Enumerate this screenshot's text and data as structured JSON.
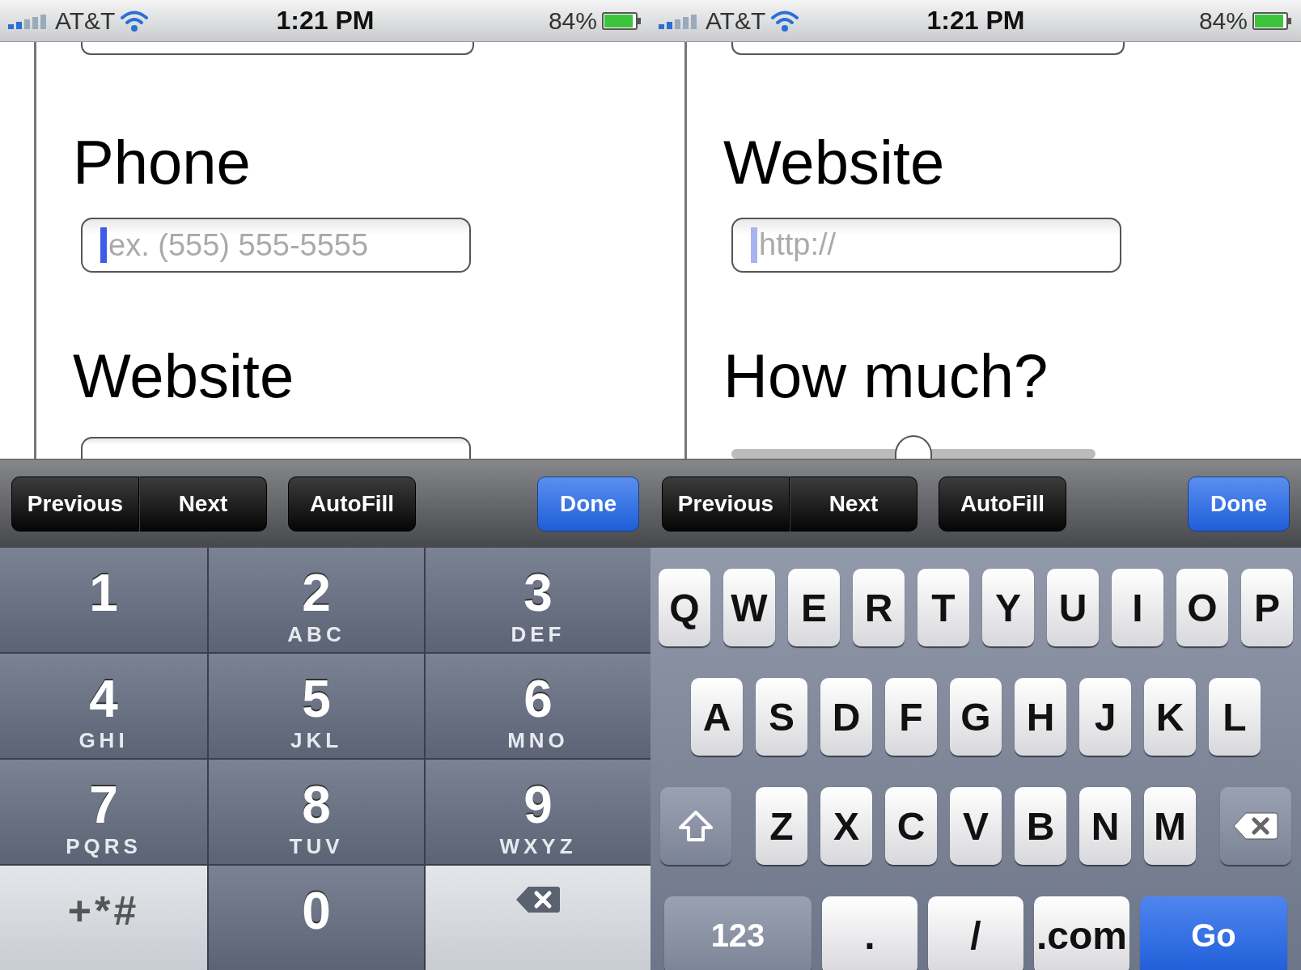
{
  "screens": [
    {
      "status_bar": {
        "carrier": "AT&T",
        "time": "1:21 PM",
        "battery": "84%"
      },
      "form": [
        {
          "kind": "field-edge"
        },
        {
          "kind": "label",
          "text": "Phone"
        },
        {
          "kind": "field",
          "placeholder": "ex. (555) 555-5555",
          "focused": true
        },
        {
          "kind": "label",
          "text": "Website"
        },
        {
          "kind": "field",
          "focused": false
        }
      ],
      "toolbar": [
        {
          "kind": "segment",
          "label": "Previous"
        },
        {
          "kind": "segment",
          "label": "Next"
        },
        {
          "kind": "plain",
          "label": "AutoFill"
        },
        {
          "kind": "primary",
          "label": "Done"
        }
      ],
      "keyboard": {
        "kind": "phone",
        "keys": [
          {
            "kind": "digit",
            "digit": "1"
          },
          {
            "kind": "digit",
            "digit": "2",
            "letters": "ABC"
          },
          {
            "kind": "digit",
            "digit": "3",
            "letters": "DEF"
          },
          {
            "kind": "digit",
            "digit": "4",
            "letters": "GHI"
          },
          {
            "kind": "digit",
            "digit": "5",
            "letters": "JKL"
          },
          {
            "kind": "digit",
            "digit": "6",
            "letters": "MNO"
          },
          {
            "kind": "digit",
            "digit": "7",
            "letters": "PQRS"
          },
          {
            "kind": "digit",
            "digit": "8",
            "letters": "TUV"
          },
          {
            "kind": "digit",
            "digit": "9",
            "letters": "WXYZ"
          },
          {
            "kind": "symbols",
            "label": "+*#"
          },
          {
            "kind": "digit",
            "digit": "0"
          },
          {
            "kind": "backspace"
          }
        ]
      }
    },
    {
      "status_bar": {
        "carrier": "AT&T",
        "time": "1:21 PM",
        "battery": "84%"
      },
      "form": [
        {
          "kind": "field-edge"
        },
        {
          "kind": "label",
          "text": "Website"
        },
        {
          "kind": "field",
          "placeholder": "http://",
          "focused": true
        },
        {
          "kind": "label",
          "text": "How much?"
        },
        {
          "kind": "slider",
          "level": 0.5
        }
      ],
      "toolbar": [
        {
          "kind": "segment",
          "label": "Previous"
        },
        {
          "kind": "segment",
          "label": "Next"
        },
        {
          "kind": "plain",
          "label": "AutoFill"
        },
        {
          "kind": "primary",
          "label": "Done"
        }
      ],
      "keyboard": {
        "kind": "qwerty",
        "rows": [
          [
            {
              "kind": "letter",
              "label": "Q"
            },
            {
              "kind": "letter",
              "label": "W"
            },
            {
              "kind": "letter",
              "label": "E"
            },
            {
              "kind": "letter",
              "label": "R"
            },
            {
              "kind": "letter",
              "label": "T"
            },
            {
              "kind": "letter",
              "label": "Y"
            },
            {
              "kind": "letter",
              "label": "U"
            },
            {
              "kind": "letter",
              "label": "I"
            },
            {
              "kind": "letter",
              "label": "O"
            },
            {
              "kind": "letter",
              "label": "P"
            }
          ],
          [
            {
              "kind": "letter",
              "label": "A"
            },
            {
              "kind": "letter",
              "label": "S"
            },
            {
              "kind": "letter",
              "label": "D"
            },
            {
              "kind": "letter",
              "label": "F"
            },
            {
              "kind": "letter",
              "label": "G"
            },
            {
              "kind": "letter",
              "label": "H"
            },
            {
              "kind": "letter",
              "label": "J"
            },
            {
              "kind": "letter",
              "label": "K"
            },
            {
              "kind": "letter",
              "label": "L"
            }
          ],
          [
            {
              "kind": "shift"
            },
            {
              "kind": "letter",
              "label": "Z"
            },
            {
              "kind": "letter",
              "label": "X"
            },
            {
              "kind": "letter",
              "label": "C"
            },
            {
              "kind": "letter",
              "label": "V"
            },
            {
              "kind": "letter",
              "label": "B"
            },
            {
              "kind": "letter",
              "label": "N"
            },
            {
              "kind": "letter",
              "label": "M"
            },
            {
              "kind": "backspace"
            }
          ]
        ],
        "bottom_row": [
          {
            "kind": "mode",
            "label": "123"
          },
          {
            "kind": "char",
            "label": "."
          },
          {
            "kind": "char",
            "label": "/"
          },
          {
            "kind": "char",
            "label": ".com"
          },
          {
            "kind": "go",
            "label": "Go"
          }
        ]
      }
    }
  ]
}
